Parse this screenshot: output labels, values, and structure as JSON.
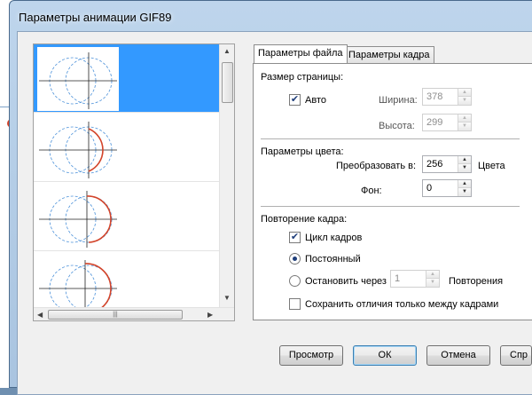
{
  "dialog": {
    "title": "Параметры анимации GIF89"
  },
  "tabs": [
    {
      "label": "Параметры файла",
      "active": true
    },
    {
      "label": "Параметры кадра",
      "active": false
    }
  ],
  "page_size": {
    "section_label": "Размер страницы:",
    "auto_label": "Авто",
    "auto_checked": true,
    "width_label": "Ширина:",
    "width_value": "378",
    "height_label": "Высота:",
    "height_value": "299"
  },
  "color": {
    "section_label": "Параметры цвета:",
    "convert_label": "Преобразовать в:",
    "convert_value": "256",
    "colors_unit": "Цвета",
    "background_label": "Фон:",
    "background_value": "0"
  },
  "repeat": {
    "section_label": "Повторение кадра:",
    "loop_label": "Цикл кадров",
    "loop_checked": true,
    "constant_label": "Постоянный",
    "constant_selected": true,
    "stop_label": "Остановить через",
    "stop_value": "1",
    "repeats_label": "Повторения",
    "save_diff_label": "Сохранить отличия только между кадрами",
    "save_diff_checked": false
  },
  "buttons": {
    "preview": "Просмотр",
    "ok": "ОК",
    "cancel": "Отмена",
    "help": "Спр"
  },
  "colors": {
    "selection": "#3399ff",
    "accent_red": "#d3442a",
    "guide_blue": "#4a90d9"
  }
}
